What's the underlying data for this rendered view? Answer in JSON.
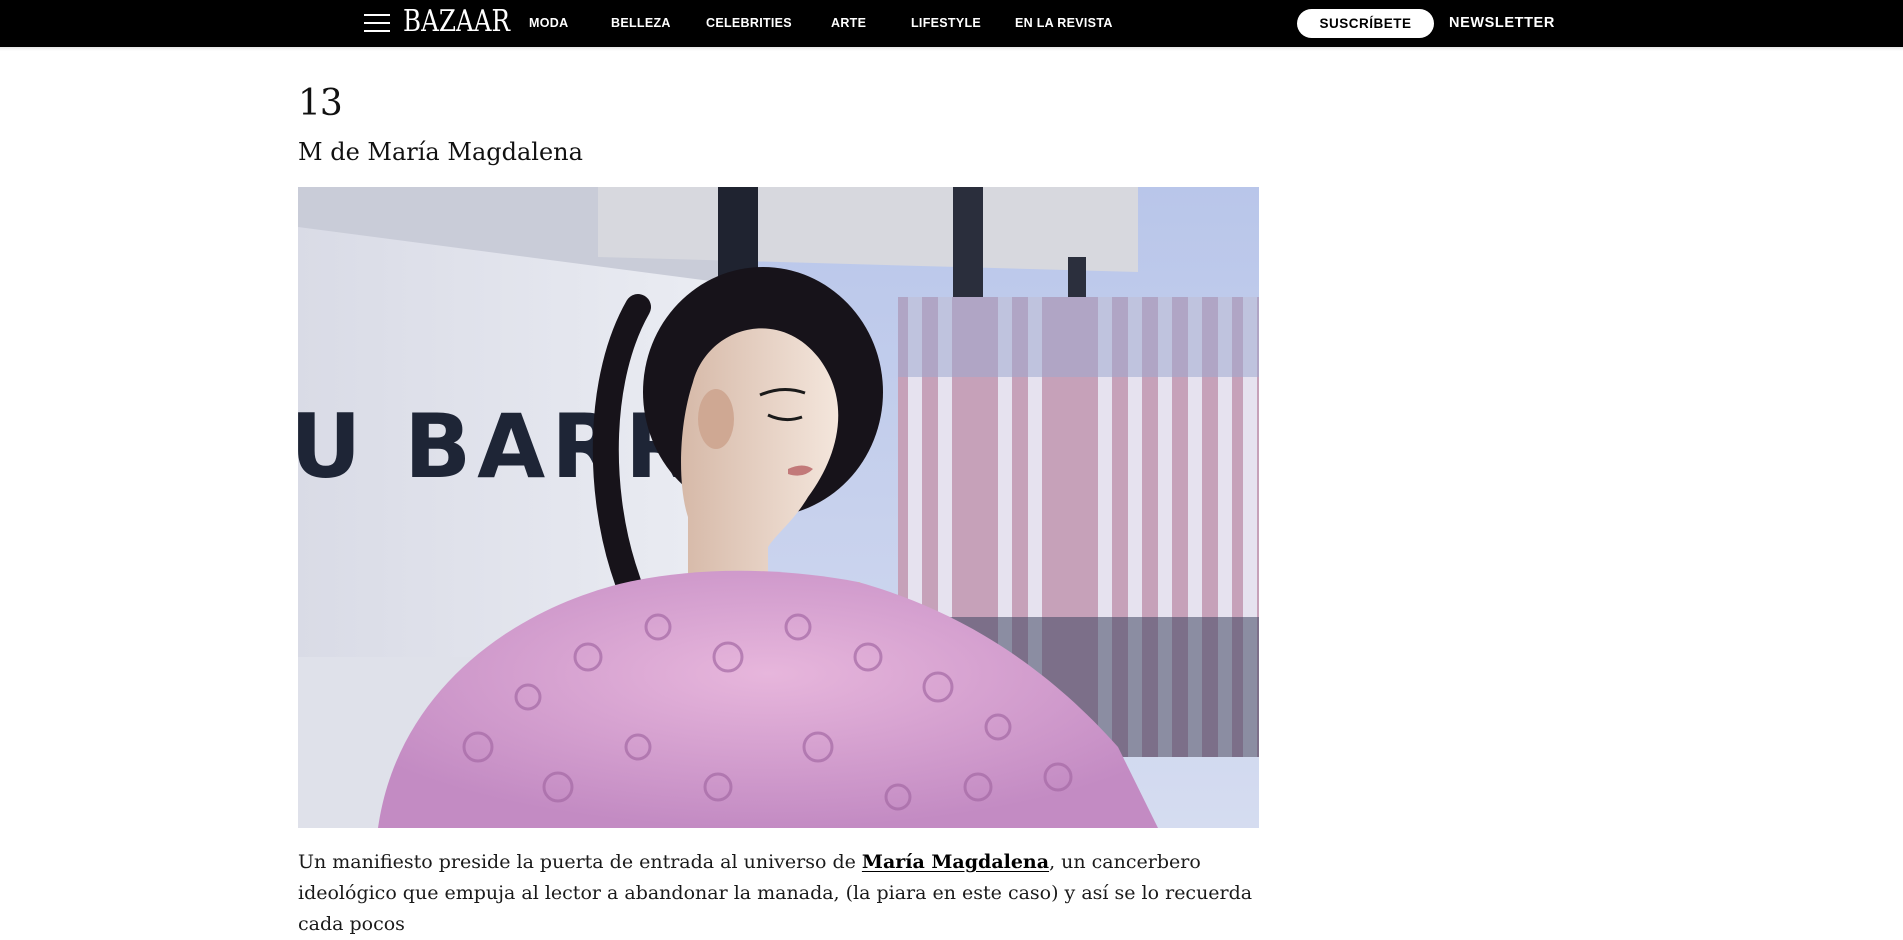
{
  "header": {
    "logo": "BAZAAR",
    "nav": [
      "MODA",
      "BELLEZA",
      "CELEBRITIES",
      "ARTE",
      "LIFESTYLE",
      "EN LA REVISTA"
    ],
    "subscribe_label": "SUSCRÍBETE",
    "newsletter_label": "NEWSLETTER"
  },
  "article": {
    "item_number": "13",
    "item_title": "M de María Magdalena",
    "photo_sign_text": "U BARRIO",
    "paragraph": {
      "before": "Un manifiesto preside la puerta de entrada al universo de ",
      "link": "María Magdalena",
      "after": ", un cancerbero ideológico que empuja al lector a abandonar la manada, (la piara en este caso) y así se lo recuerda cada pocos"
    }
  },
  "icons": {
    "menu": "hamburger-menu-icon"
  },
  "colors": {
    "topbar": "#000000",
    "text": "#111111",
    "button_bg": "#ffffff"
  }
}
